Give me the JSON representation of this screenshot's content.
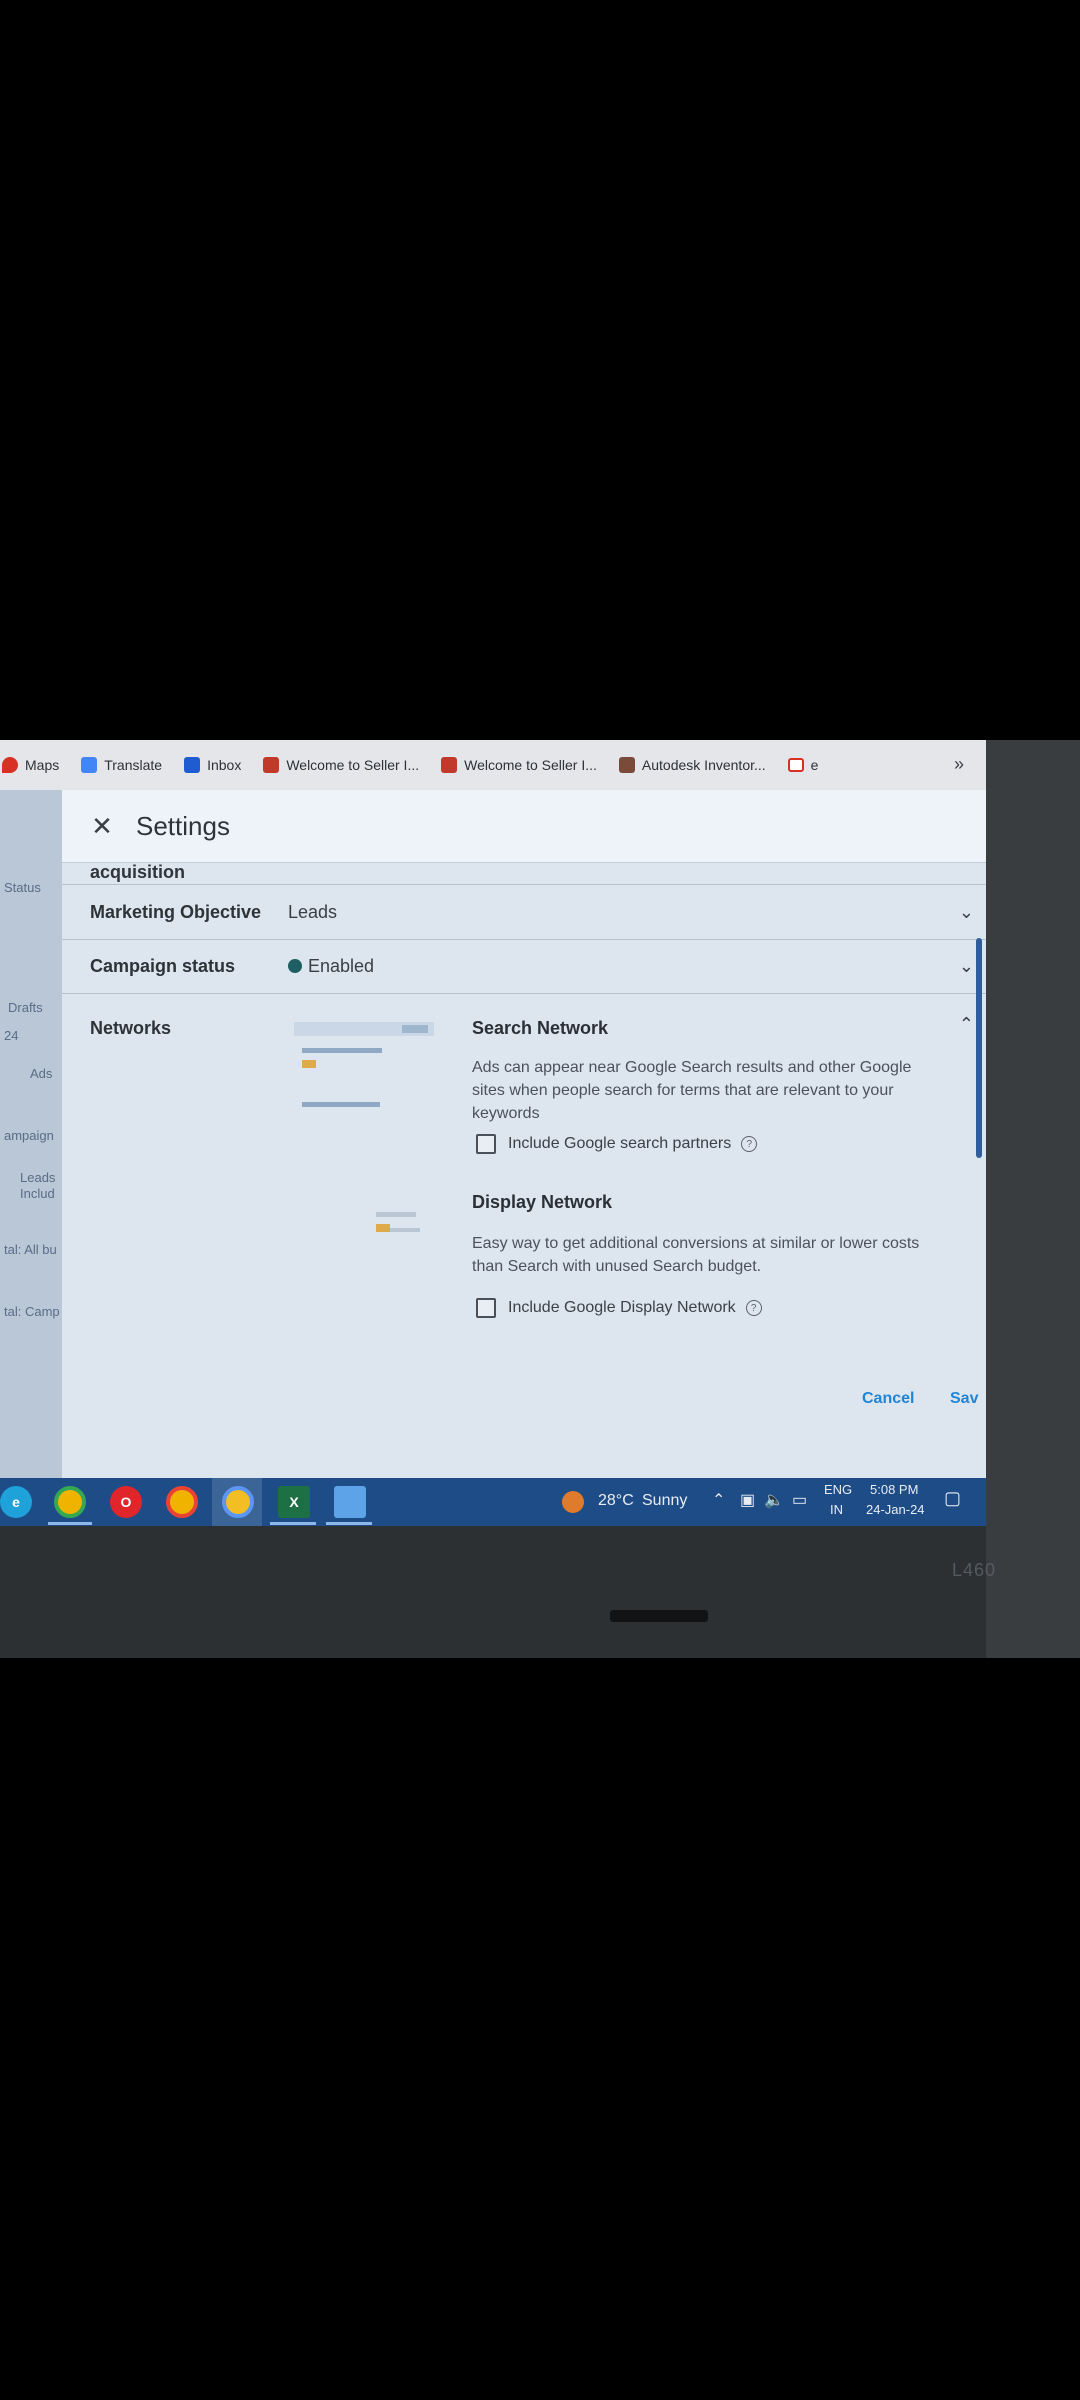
{
  "browser": {
    "bookmarks": [
      {
        "label": "Maps",
        "icon": "maps-pin-icon",
        "color": "#d93025"
      },
      {
        "label": "Translate",
        "icon": "translate-icon",
        "color": "#4285f4"
      },
      {
        "label": "Inbox",
        "icon": "inbox-icon",
        "color": "#1f5bd1"
      },
      {
        "label": "Welcome to Seller I...",
        "icon": "seller-icon",
        "color": "#c0392b"
      },
      {
        "label": "Welcome to Seller I...",
        "icon": "seller-icon",
        "color": "#c0392b"
      },
      {
        "label": "Autodesk Inventor...",
        "icon": "autodesk-icon",
        "color": "#7a4a3a"
      },
      {
        "label": "e",
        "icon": "gmail-icon",
        "color": "#d93025"
      }
    ],
    "more_label": "»"
  },
  "background_page": {
    "fragments": [
      "Status",
      "Drafts",
      "24",
      "Ads",
      "ampaign",
      "Leads",
      "Includ",
      "tal: All bu",
      "tal: Camp"
    ]
  },
  "settings": {
    "title": "Settings",
    "close_icon": "close-icon",
    "partial_row": "acquisition",
    "marketing_objective": {
      "label": "Marketing Objective",
      "value": "Leads"
    },
    "campaign_status": {
      "label": "Campaign status",
      "value": "Enabled",
      "dot_color": "#1f5f63"
    },
    "networks": {
      "label": "Networks",
      "search": {
        "title": "Search Network",
        "description": "Ads can appear near Google Search results and other Google sites when people search for terms that are relevant to your keywords",
        "checkbox_label": "Include Google search partners",
        "checked": false
      },
      "display": {
        "title": "Display Network",
        "description": "Easy way to get additional conversions at similar or lower costs than Search with unused Search budget.",
        "checkbox_label": "Include Google Display Network",
        "checked": false
      }
    },
    "footer": {
      "cancel": "Cancel",
      "save": "Sav"
    }
  },
  "taskbar": {
    "apps": [
      "edge-icon",
      "chrome-icon",
      "opera-icon",
      "chrome-icon",
      "chrome-icon",
      "excel-icon",
      "notepad-icon"
    ],
    "weather": {
      "temp": "28°C",
      "condition": "Sunny"
    },
    "language": {
      "top": "ENG",
      "bottom": "IN"
    },
    "time": "5:08 PM",
    "date": "24-Jan-24"
  },
  "laptop": {
    "model": "L460"
  }
}
